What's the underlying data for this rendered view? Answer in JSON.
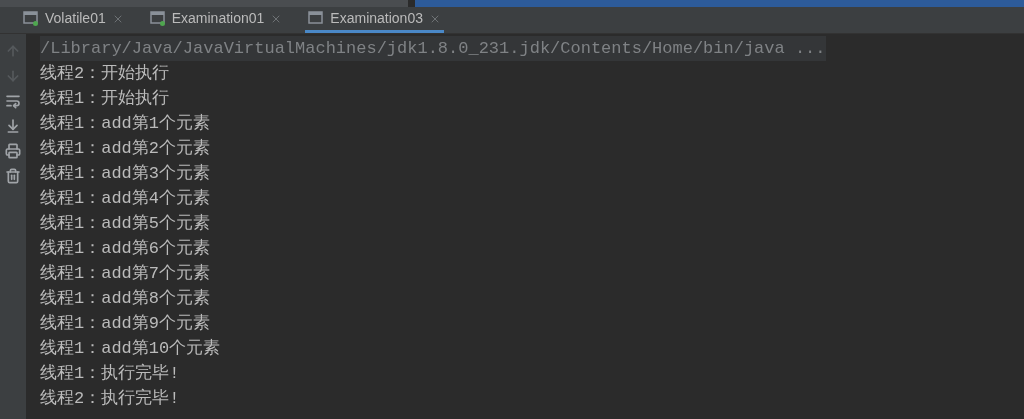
{
  "tabs": [
    {
      "label": "Volatile01",
      "running": true,
      "selected": false
    },
    {
      "label": "Examination01",
      "running": true,
      "selected": false
    },
    {
      "label": "Examination03",
      "running": false,
      "selected": true
    }
  ],
  "toolbar": [
    {
      "kind": "up",
      "disabled": true
    },
    {
      "kind": "down",
      "disabled": true
    },
    {
      "kind": "wrap",
      "disabled": false
    },
    {
      "kind": "scroll-end",
      "disabled": false
    },
    {
      "kind": "print",
      "disabled": false
    },
    {
      "kind": "trash",
      "disabled": false
    }
  ],
  "console": {
    "command": "/Library/Java/JavaVirtualMachines/jdk1.8.0_231.jdk/Contents/Home/bin/java ...",
    "lines": [
      "线程2：开始执行",
      "线程1：开始执行",
      "线程1：add第1个元素",
      "线程1：add第2个元素",
      "线程1：add第3个元素",
      "线程1：add第4个元素",
      "线程1：add第5个元素",
      "线程1：add第6个元素",
      "线程1：add第7个元素",
      "线程1：add第8个元素",
      "线程1：add第9个元素",
      "线程1：add第10个元素",
      "线程1：执行完毕!",
      "线程2：执行完毕!"
    ]
  }
}
